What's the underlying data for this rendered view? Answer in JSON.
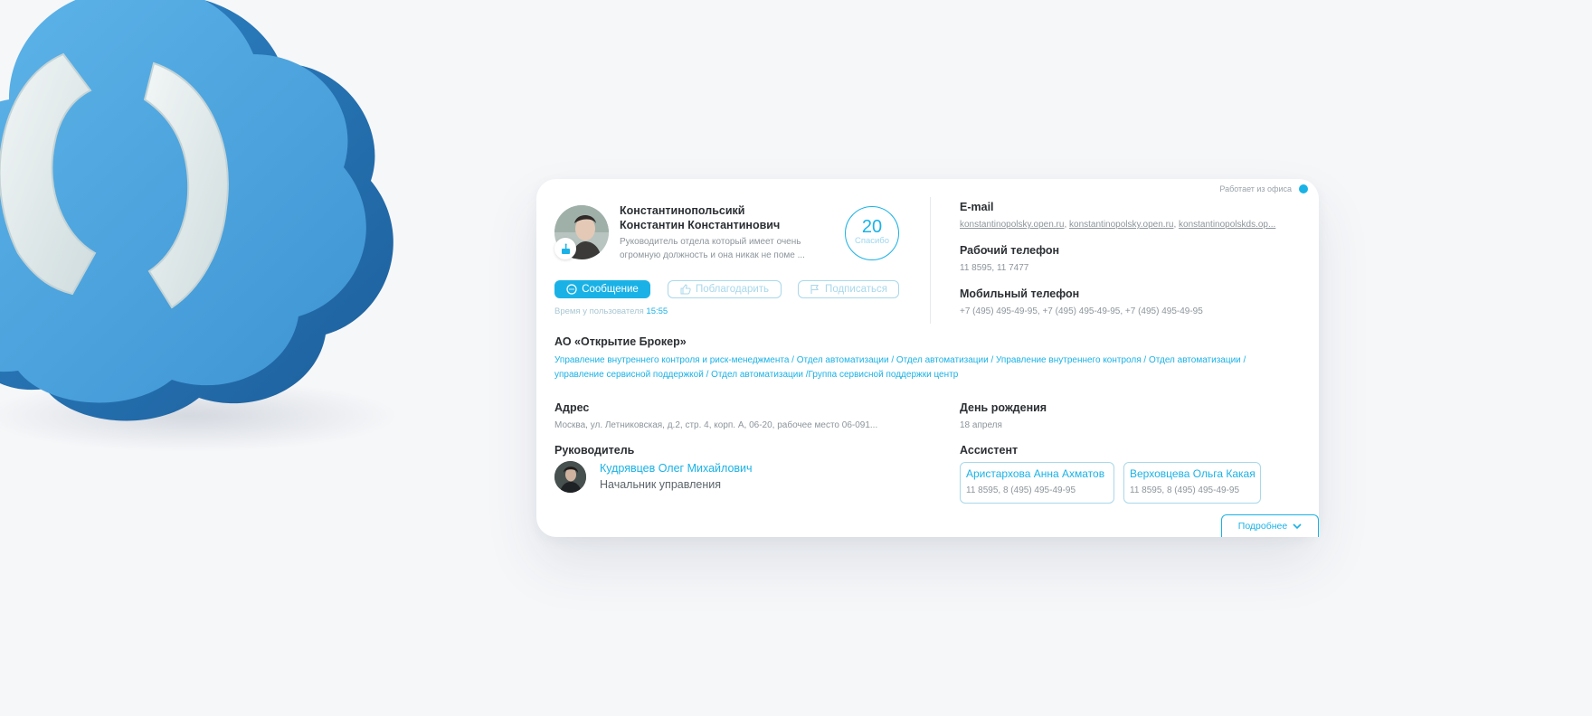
{
  "status": {
    "text": "Работает из офиса",
    "color": "#1ab2e6"
  },
  "profile": {
    "name_line1": "Константинопольсикй",
    "name_line2": "Константин Константинович",
    "position": "Руководитель отдела который  имеет очень огромную должность и она никак не поме ...",
    "thanks_count": "20",
    "thanks_label": "Спасибо",
    "birthday_icon": "cake-icon"
  },
  "actions": {
    "message": "Сообщение",
    "thank": "Поблагодарить",
    "subscribe": "Подписаться"
  },
  "user_time": {
    "label": "Время у пользователя",
    "value": "15:55"
  },
  "contacts": {
    "email_title": "E-mail",
    "emails": [
      "konstantinopolsky.open.ru",
      "konstantinopolsky.open.ru",
      "konstantinopolskds.op..."
    ],
    "work_phone_title": "Рабочий телефон",
    "work_phone": "11 8595, 11 7477",
    "mobile_title": "Мобильный телефон",
    "mobile": "+7 (495) 495-49-95, +7 (495) 495-49-95, +7 (495) 495-49-95"
  },
  "company": {
    "name": "АО «Открытие Брокер»",
    "path": "Управление внутреннего контроля и риск-менеджмента / Отдел автоматизации / Отдел автоматизации / Управление внутреннего контроля  / Отдел автоматизации / управление сервисной поддержкой / Отдел автоматизации /Группа сервисной поддержки центр"
  },
  "address": {
    "title": "Адрес",
    "value": "Москва, ул. Летниковская, д.2, стр. 4, корп. А, 06-20, рабочее место 06-091..."
  },
  "birthday": {
    "title": "День рождения",
    "value": "18 апреля"
  },
  "manager": {
    "title": "Руководитель",
    "name": "Кудрявцев Олег Михайлович",
    "role": "Начальник управления"
  },
  "assistant": {
    "title": "Ассистент",
    "items": [
      {
        "name": "Аристархова Анна Ахматов",
        "phone": "11 8595, 8 (495) 495-49-95"
      },
      {
        "name": "Верховцева Ольга Какая",
        "phone": "11 8595, 8 (495) 495-49-95"
      }
    ]
  },
  "more": {
    "label": "Подробнее"
  },
  "colors": {
    "accent": "#1ab2e6",
    "text": "#2b2f33",
    "muted": "#8d959b",
    "background": "#f6f7f9"
  }
}
